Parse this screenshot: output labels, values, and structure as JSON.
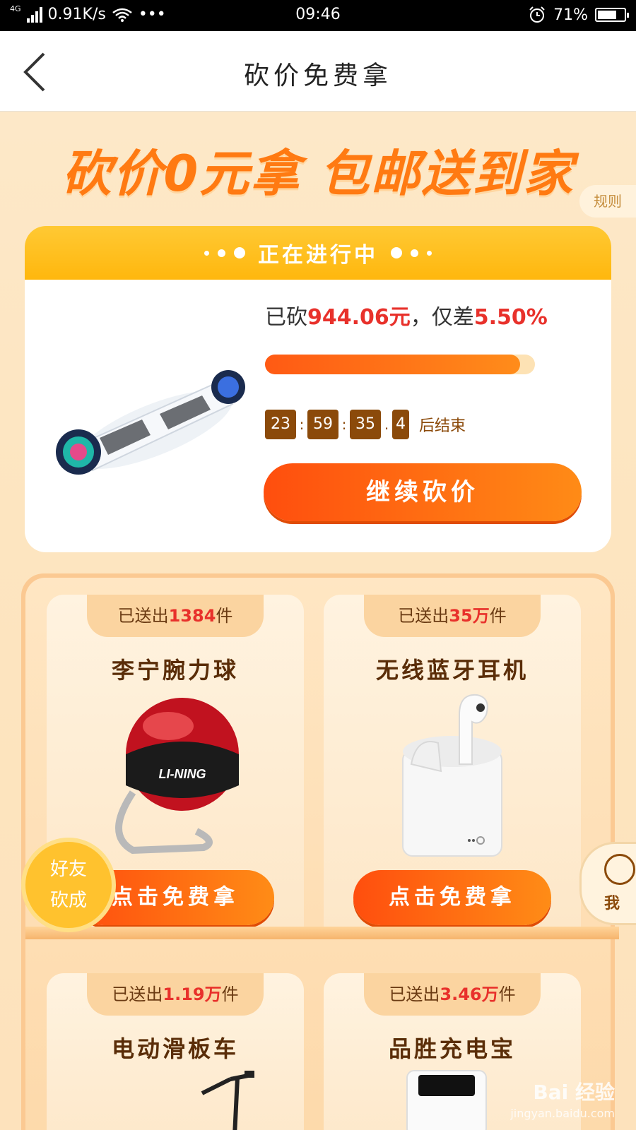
{
  "status_bar": {
    "network_gen": "4G",
    "speed": "0.91K/s",
    "more": "•••",
    "time": "09:46",
    "battery": "71%",
    "battery_level": 0.71
  },
  "nav": {
    "title": "砍价免费拿"
  },
  "banner": {
    "headline": "砍价0元拿 包邮送到家",
    "rules_label": "规则"
  },
  "active": {
    "header": "正在进行中",
    "cut_prefix": "已砍",
    "cut_amount": "944.06元",
    "cut_middle": "，仅差",
    "remaining": "5.50%",
    "progress": 0.945,
    "countdown": {
      "hours": "23",
      "minutes": "59",
      "seconds": "35",
      "tenths": "4",
      "suffix": "后结束"
    },
    "continue_label": "继续砍价"
  },
  "products": [
    {
      "sent_prefix": "已送出",
      "sent_count": "1384",
      "sent_suffix": "件",
      "name": "李宁腕力球",
      "brand": "LI-NING",
      "button": "点击免费拿"
    },
    {
      "sent_prefix": "已送出",
      "sent_count": "35万",
      "sent_suffix": "件",
      "name": "无线蓝牙耳机",
      "button": "点击免费拿"
    },
    {
      "sent_prefix": "已送出",
      "sent_count": "1.19万",
      "sent_suffix": "件",
      "name": "电动滑板车"
    },
    {
      "sent_prefix": "已送出",
      "sent_count": "3.46万",
      "sent_suffix": "件",
      "name": "品胜充电宝"
    }
  ],
  "floating": {
    "friend_line1": "好友",
    "friend_line2": "砍成",
    "me_label": "我"
  },
  "watermark": {
    "brand": "Bai 经验",
    "url": "jingyan.baidu.com"
  },
  "colors": {
    "accent_orange": "#ff7a12",
    "button_red": "#ff4e0e",
    "highlight_red": "#e8312b",
    "brown": "#8b4a0a",
    "yellow": "#ffc22e"
  }
}
